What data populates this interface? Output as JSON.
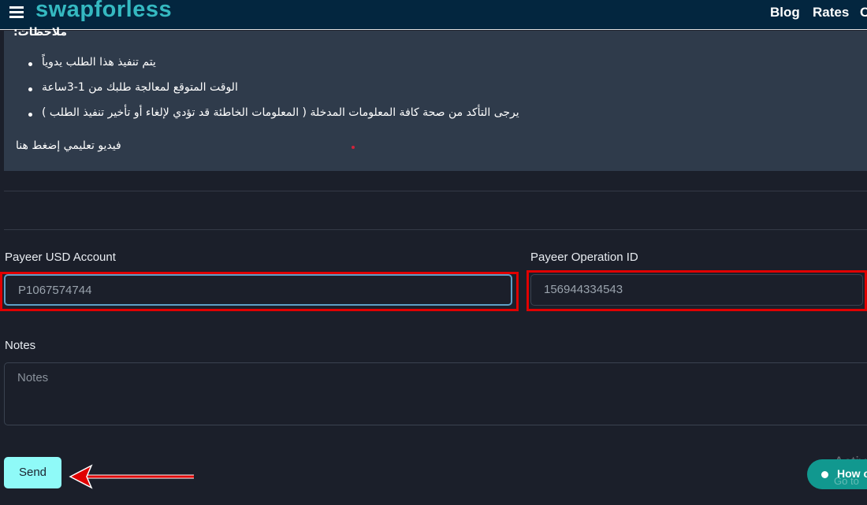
{
  "header": {
    "logo": "swapforless",
    "nav": [
      "Blog",
      "Rates",
      "C"
    ]
  },
  "notes_box": {
    "heading": "ملاحظات:",
    "items": [
      "يتم تنفيذ هذا الطلب يدوياً",
      "الوقت المتوقع لمعالجة طلبك من 1-3ساعة",
      "يرجى التأكد من صحة كافة المعلومات المدخلة ( المعلومات الخاطئة قد تؤدي لإلغاء أو تأخير تنفيذ الطلب )"
    ],
    "video_link": "فيديو تعليمي إضغط هنا"
  },
  "form": {
    "account_label": "Payeer USD Account",
    "account_value": "P1067574744",
    "operation_label": "Payeer Operation ID",
    "operation_value": "156944334543",
    "notes_label": "Notes",
    "notes_placeholder": "Notes",
    "send_label": "Send"
  },
  "chat_widget": {
    "label": "How c"
  },
  "watermark": {
    "line1": "Activ",
    "line2": "Go to"
  },
  "colors": {
    "brand": "#35b9c1",
    "header": "#03263f",
    "send": "#8ffaf8",
    "highlight": "#e00000"
  }
}
